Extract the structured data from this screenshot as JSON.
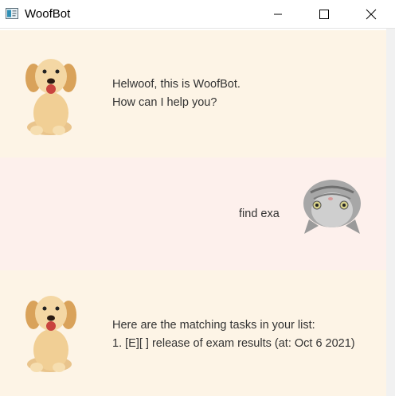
{
  "window": {
    "title": "WoofBot",
    "controls": {
      "minimize": "minimize-icon",
      "maximize": "maximize-icon",
      "close": "close-icon"
    }
  },
  "colors": {
    "bot_bg": "#fdf4e6",
    "user_bg": "#fdf0ec",
    "text": "#333333"
  },
  "messages": [
    {
      "sender": "bot",
      "avatar": "puppy-avatar",
      "lines": [
        "Helwoof, this is WoofBot.",
        "How can I help you?"
      ]
    },
    {
      "sender": "user",
      "avatar": "kitten-avatar",
      "lines": [
        "find exa"
      ]
    },
    {
      "sender": "bot",
      "avatar": "puppy-avatar",
      "lines": [
        "Here are the matching tasks in your list:",
        "1. [E][ ] release of exam results (at: Oct 6 2021)"
      ]
    }
  ]
}
